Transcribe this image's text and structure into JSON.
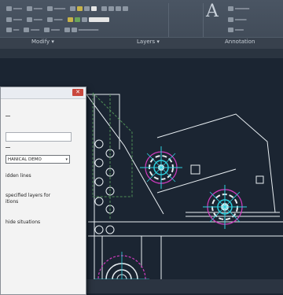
{
  "ribbon": {
    "panels": {
      "modify": "Modify ▾",
      "layers": "Layers ▾",
      "annotation": "Annotation"
    },
    "big_text_icon": "A"
  },
  "dialog": {
    "close_label": "✕",
    "dropdown_value": "HANICAL DEMO",
    "dropdown_arrow": "▾",
    "lines": [
      "idden lines",
      "specified layers for",
      "itions",
      "hide situations"
    ]
  },
  "colors": {
    "canvas_bg": "#1b2532",
    "cyan": "#2ed1e0",
    "magenta": "#d23cc0",
    "white": "#e8eef2",
    "green": "#4f8f57"
  }
}
